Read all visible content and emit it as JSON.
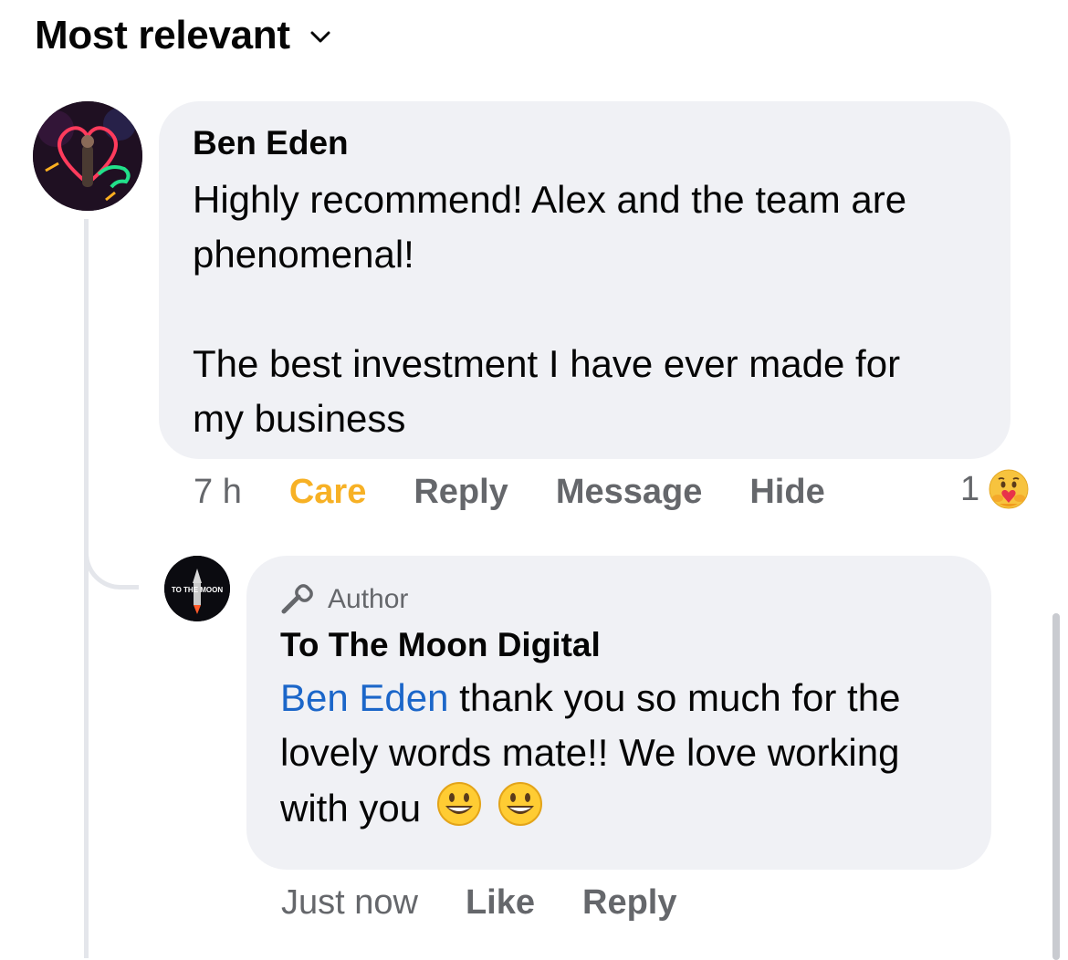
{
  "sort": {
    "label": "Most relevant"
  },
  "comment": {
    "author": "Ben Eden",
    "lines": [
      "Highly recommend! Alex and the team are",
      "phenomenal!"
    ],
    "lines2": [
      "The best investment I have ever made for",
      "my business"
    ],
    "time": "7 h",
    "reaction_label": "Care",
    "reply_label": "Reply",
    "message_label": "Message",
    "hide_label": "Hide",
    "reaction_count": "1"
  },
  "reply": {
    "badge": "Author",
    "author": "To The Moon Digital",
    "mention": "Ben Eden",
    "text_line1": " thank you so much for the",
    "text_line2": "lovely words mate!! We love working",
    "text_line3": "with you",
    "time": "Just now",
    "like_label": "Like",
    "reply_label": "Reply"
  },
  "avatar_logo_text": "TO THE MOON",
  "colors": {
    "care": "#f7b125",
    "mention": "#1b66c9",
    "bubble": "#f0f1f5",
    "muted": "#65676b"
  }
}
